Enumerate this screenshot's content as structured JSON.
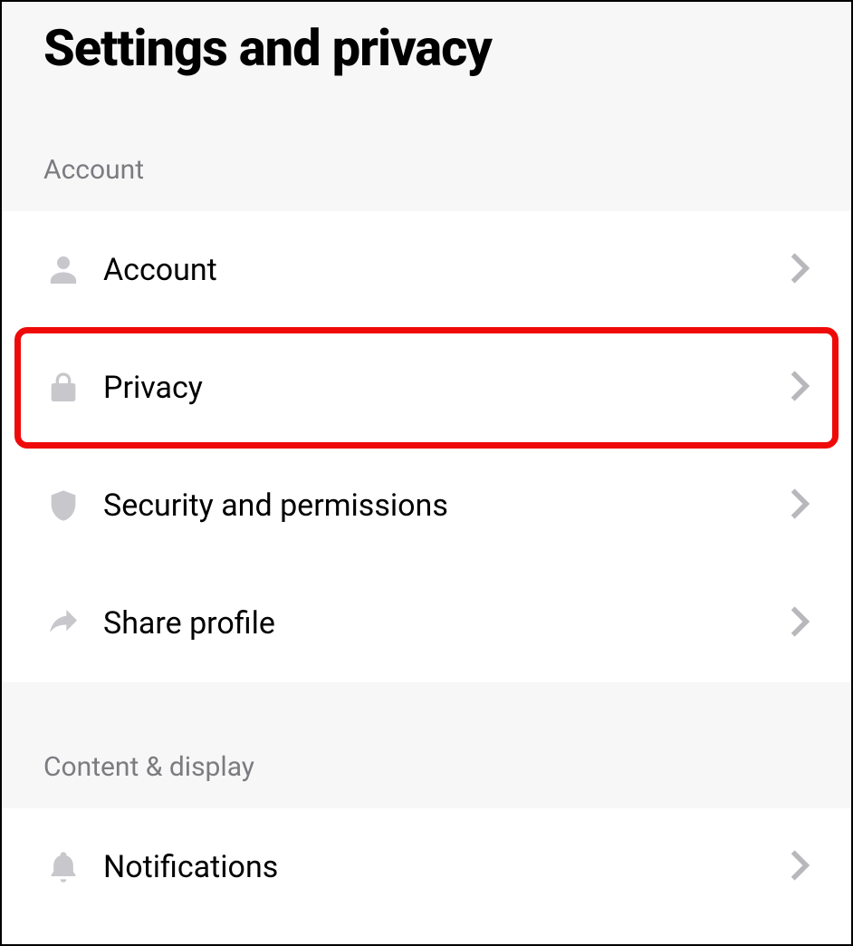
{
  "page": {
    "title": "Settings and privacy"
  },
  "sections": {
    "account": {
      "header": "Account",
      "items": [
        {
          "label": "Account",
          "icon": "person"
        },
        {
          "label": "Privacy",
          "icon": "lock",
          "highlighted": true
        },
        {
          "label": "Security and permissions",
          "icon": "shield"
        },
        {
          "label": "Share profile",
          "icon": "share"
        }
      ]
    },
    "content_display": {
      "header": "Content & display",
      "items": [
        {
          "label": "Notifications",
          "icon": "bell"
        }
      ]
    }
  }
}
